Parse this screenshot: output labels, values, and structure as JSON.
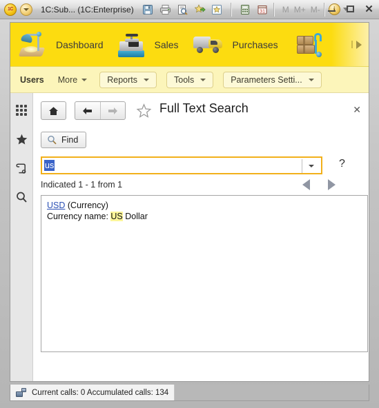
{
  "titlebar": {
    "app_icon": "1c-logo-icon",
    "dropdown_icon": "chevron-down-circle-icon",
    "title": "1C:Sub... (1C:Enterprise)",
    "icons": [
      {
        "name": "save-icon",
        "glyph": "💾"
      },
      {
        "name": "print-icon",
        "glyph": "🖨"
      },
      {
        "name": "print-preview-icon",
        "glyph": "🔍"
      },
      {
        "name": "add-favorite-icon",
        "glyph": "★"
      },
      {
        "name": "favorites-icon",
        "glyph": "☆"
      },
      {
        "name": "calculator-icon",
        "glyph": "🖩"
      },
      {
        "name": "calendar-icon",
        "glyph": "31"
      }
    ],
    "memory": [
      "M",
      "M+",
      "M-"
    ],
    "info_label": "i",
    "window_buttons": {
      "minimize": "–",
      "maximize": "□",
      "close": "✕"
    }
  },
  "nav": {
    "sections": [
      {
        "label": "Dashboard",
        "icon": "desk-lamp-icon"
      },
      {
        "label": "Sales",
        "icon": "cash-register-icon"
      },
      {
        "label": "Purchases",
        "icon": "delivery-van-icon"
      },
      {
        "label": "",
        "icon": "boxes-handcart-icon"
      }
    ],
    "overflow_icon": "more-sections-arrow-icon",
    "accent_color": "#fcdc10"
  },
  "toolbar": {
    "users_label": "Users",
    "more_label": "More",
    "buttons": [
      {
        "label": "Reports"
      },
      {
        "label": "Tools"
      },
      {
        "label": "Parameters Setti..."
      }
    ]
  },
  "sidebar": {
    "items": [
      {
        "name": "sidebar-item-sections",
        "icon": "grid-apps-icon"
      },
      {
        "name": "sidebar-item-favorites",
        "icon": "star-icon"
      },
      {
        "name": "sidebar-item-history",
        "icon": "scroll-history-icon"
      },
      {
        "name": "sidebar-item-search",
        "icon": "search-magnifier-icon"
      }
    ]
  },
  "page": {
    "home_icon": "home-icon",
    "back_icon": "arrow-left-icon",
    "forward_icon": "arrow-right-icon",
    "favorite_icon": "star-outline-icon",
    "title": "Full Text Search",
    "close_label": "✕"
  },
  "search": {
    "find_button_label": "Find",
    "find_icon": "magnifier-icon",
    "input_value": "us",
    "dropdown_icon": "chevron-down-icon",
    "help_label": "?"
  },
  "results": {
    "status_text": "Indicated 1 - 1 from 1",
    "prev_icon": "triangle-left-icon",
    "next_icon": "triangle-right-icon",
    "items": [
      {
        "link": "USD",
        "type": " (Currency)",
        "detail_prefix": "Currency name: ",
        "detail_highlight": "US",
        "detail_suffix": " Dollar"
      }
    ],
    "highlight_color": "#fbf59a",
    "link_color": "#2a4fb4"
  },
  "statusbar": {
    "network_icon": "network-computers-icon",
    "text": "Current calls: 0   Accumulated calls: 134"
  }
}
